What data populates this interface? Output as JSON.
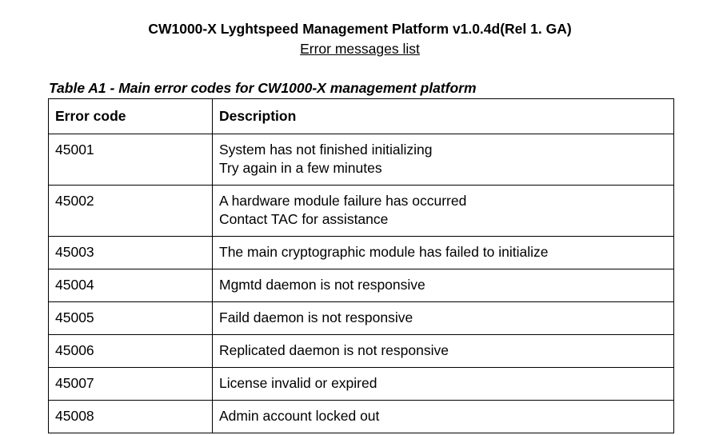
{
  "document": {
    "title": "CW1000-X Lyghtspeed Management Platform v1.0.4d(Rel 1. GA)",
    "subtitle": "Error messages list",
    "table_caption": "Table A1 - Main error codes for CW1000-X management platform"
  },
  "table": {
    "headers": {
      "code": "Error code",
      "description": "Description"
    },
    "rows": [
      {
        "code": "45001",
        "lines": [
          "System has not finished initializing",
          "Try again in a few minutes"
        ]
      },
      {
        "code": "45002",
        "lines": [
          "A hardware module failure has occurred",
          "Contact TAC for assistance"
        ]
      },
      {
        "code": "45003",
        "lines": [
          "The main cryptographic module has failed to initialize"
        ]
      },
      {
        "code": "45004",
        "lines": [
          "Mgmtd daemon is not responsive"
        ]
      },
      {
        "code": "45005",
        "lines": [
          "Faild daemon is not responsive"
        ]
      },
      {
        "code": "45006",
        "lines": [
          "Replicated daemon is not responsive"
        ]
      },
      {
        "code": "45007",
        "lines": [
          "License invalid or expired"
        ]
      },
      {
        "code": "45008",
        "lines": [
          "Admin account locked out"
        ]
      }
    ]
  }
}
